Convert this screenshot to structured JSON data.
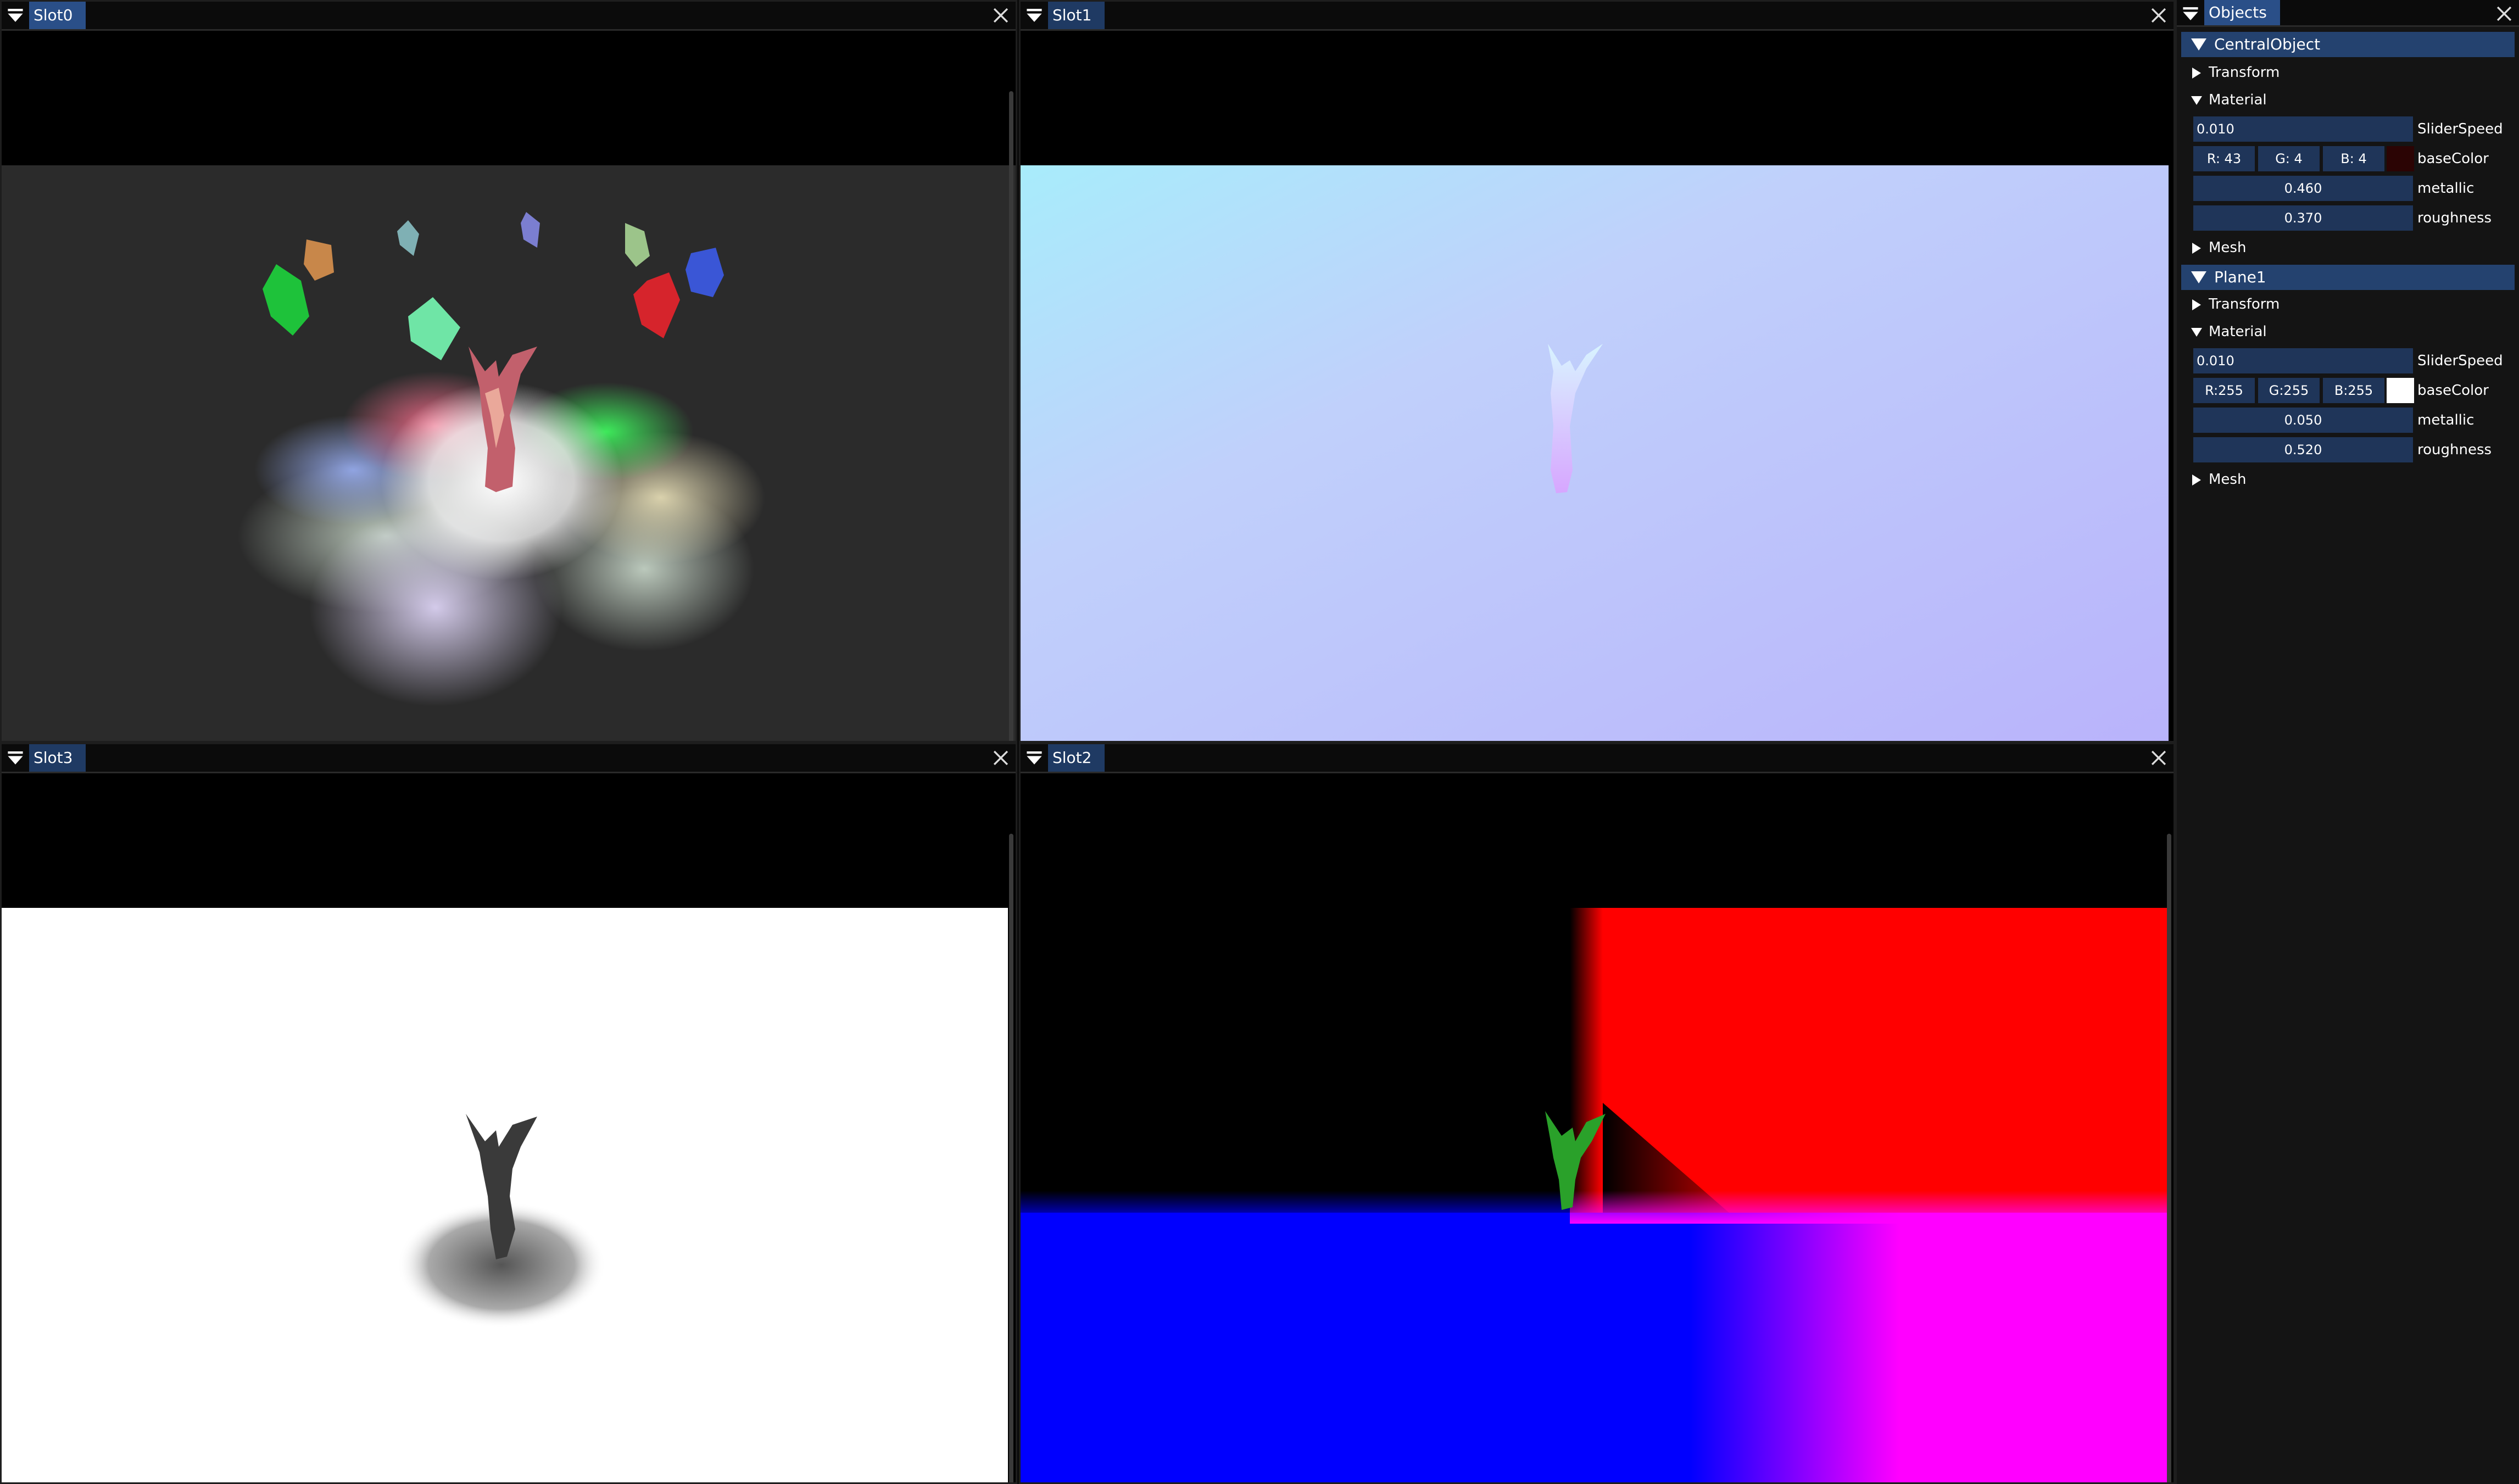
{
  "windows": {
    "slot0": {
      "title": "Slot0"
    },
    "slot1": {
      "title": "Slot1"
    },
    "slot3": {
      "title": "Slot3"
    },
    "slot2": {
      "title": "Slot2"
    }
  },
  "panel": {
    "title": "Objects",
    "objects": [
      {
        "name": "CentralObject",
        "transform": "Transform",
        "material": "Material",
        "slider_speed": {
          "value": "0.010",
          "label": "SliderSpeed"
        },
        "base_color": {
          "r": "R: 43",
          "g": "G:  4",
          "b": "B:  4",
          "label": "baseColor",
          "swatch": "#2b0404"
        },
        "metallic": {
          "value": "0.460",
          "label": "metallic"
        },
        "roughness": {
          "value": "0.370",
          "label": "roughness"
        },
        "mesh": "Mesh"
      },
      {
        "name": "Plane1",
        "transform": "Transform",
        "material": "Material",
        "slider_speed": {
          "value": "0.010",
          "label": "SliderSpeed"
        },
        "base_color": {
          "r": "R:255",
          "g": "G:255",
          "b": "B:255",
          "label": "baseColor",
          "swatch": "#ffffff"
        },
        "metallic": {
          "value": "0.050",
          "label": "metallic"
        },
        "roughness": {
          "value": "0.520",
          "label": "roughness"
        },
        "mesh": "Mesh"
      }
    ]
  },
  "colors": {
    "accent": "#2a4f88",
    "field_bg": "#1f3559",
    "panel_bg": "#141414"
  }
}
